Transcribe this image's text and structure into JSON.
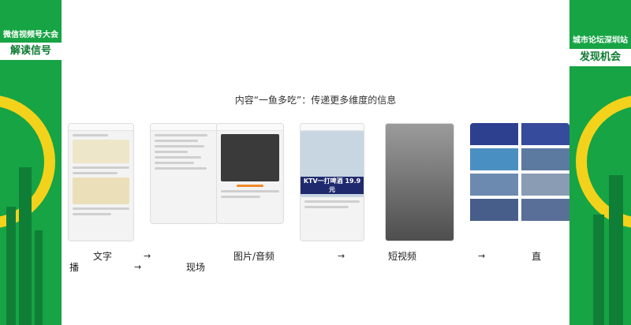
{
  "left_banner": {
    "line1": "微信视频号大会",
    "line2": "解读信号"
  },
  "right_banner": {
    "line1": "城市论坛深圳站",
    "line2": "发现机会"
  },
  "heading": "内容“一鱼多吃”：传递更多维度的信息",
  "flow": {
    "labels": [
      "文字",
      "现场",
      "图片/音频",
      "短视频",
      "直",
      "播"
    ],
    "arrow": "→"
  },
  "phone_texts": {
    "ktv_banner": "KTV一打啤酒 19.9元"
  }
}
